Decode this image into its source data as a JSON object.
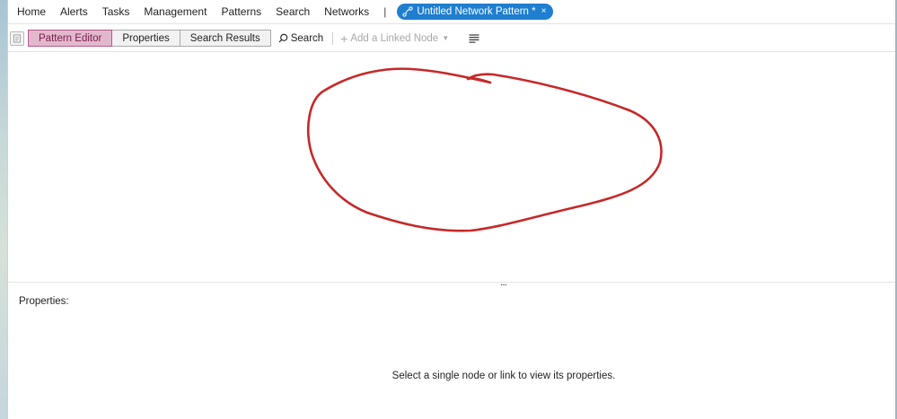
{
  "nav": {
    "items": [
      {
        "label": "Home"
      },
      {
        "label": "Alerts"
      },
      {
        "label": "Tasks"
      },
      {
        "label": "Management"
      },
      {
        "label": "Patterns"
      },
      {
        "label": "Search"
      },
      {
        "label": "Networks"
      }
    ],
    "separator": "|",
    "active_tab": {
      "label": "Untitled Network Pattern *",
      "icon": "network-pattern-icon",
      "close": "×"
    },
    "accent_color": "#1f7ed0"
  },
  "toolbar": {
    "views": [
      {
        "label": "Pattern Editor",
        "active": true
      },
      {
        "label": "Properties",
        "active": false
      },
      {
        "label": "Search Results",
        "active": false
      }
    ],
    "search_label": "Search",
    "add_node_label": "Add a Linked Node",
    "add_node_enabled": false,
    "active_color": "#e2b8cd"
  },
  "splitter": {
    "grip": "...."
  },
  "properties": {
    "title": "Properties:",
    "empty_message": "Select a single node or link to view its properties."
  },
  "annotation": {
    "shape": "hand-drawn-loop",
    "color": "#c62828"
  }
}
